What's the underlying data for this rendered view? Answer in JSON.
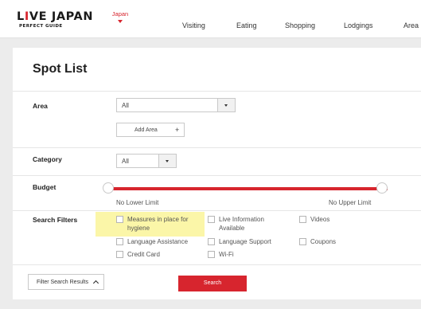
{
  "header": {
    "logo": {
      "main_prefix": "L",
      "main_accent": "I",
      "main_rest": "VE JAPAN",
      "sub": "PERFECT GUIDE"
    },
    "language": "Japan",
    "nav": [
      "Visiting",
      "Eating",
      "Shopping",
      "Lodgings",
      "Area"
    ]
  },
  "page": {
    "title": "Spot List"
  },
  "filters": {
    "area": {
      "label": "Area",
      "value": "All",
      "add_label": "Add Area",
      "add_symbol": "+"
    },
    "category": {
      "label": "Category",
      "value": "All"
    },
    "budget": {
      "label": "Budget",
      "min_label": "No Lower Limit",
      "max_label": "No Upper Limit",
      "range_selected": [
        0,
        1
      ]
    },
    "search_filters": {
      "label": "Search Filters",
      "options": [
        {
          "label": "Measures in place for",
          "label2": "hygiene",
          "checked": false,
          "highlighted": true
        },
        {
          "label": "Live Information",
          "label2": "Available",
          "checked": false
        },
        {
          "label": "Videos",
          "checked": false
        },
        {
          "label": "Language Assistance",
          "checked": false
        },
        {
          "label": "Language Support",
          "checked": false
        },
        {
          "label": "Coupons",
          "checked": false
        },
        {
          "label": "Credit Card",
          "checked": false
        },
        {
          "label": "Wi-Fi",
          "checked": false
        }
      ]
    }
  },
  "actions": {
    "filter_results_label": "Filter Search Results",
    "search_label": "Search"
  },
  "colors": {
    "accent": "#d7252e",
    "highlight": "#fbf6a8"
  }
}
